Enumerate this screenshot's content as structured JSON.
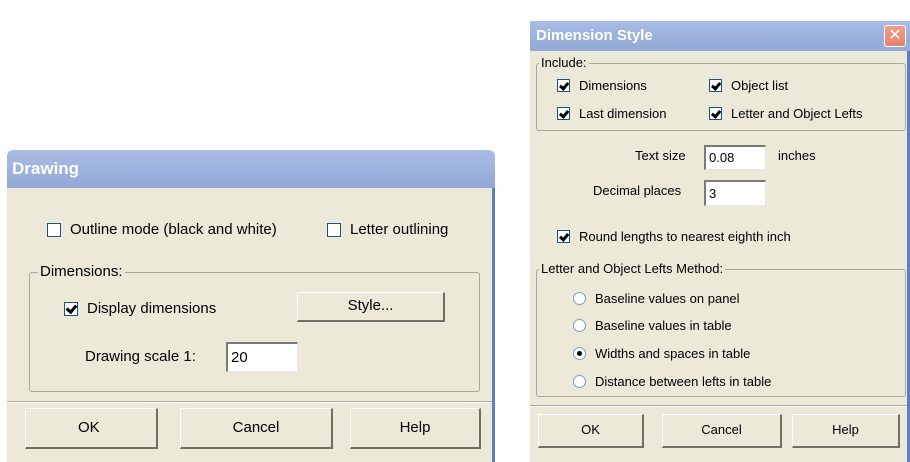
{
  "drawing_dialog": {
    "title": "Drawing",
    "outline_mode_label": "Outline mode (black and white)",
    "outline_mode_checked": false,
    "letter_outlining_label": "Letter outlining",
    "letter_outlining_checked": false,
    "dimensions_group_label": "Dimensions:",
    "display_dimensions_label": "Display dimensions",
    "display_dimensions_checked": true,
    "style_button_label": "Style...",
    "drawing_scale_label": "Drawing scale 1:",
    "drawing_scale_value": "20",
    "ok_label": "OK",
    "cancel_label": "Cancel",
    "help_label": "Help"
  },
  "dimension_style_dialog": {
    "title": "Dimension Style",
    "close_glyph": "✕",
    "include_group_label": "Include:",
    "checkboxes": [
      {
        "label": "Dimensions",
        "checked": true
      },
      {
        "label": "Object list",
        "checked": true
      },
      {
        "label": "Last dimension",
        "checked": true
      },
      {
        "label": "Letter and Object Lefts",
        "checked": true
      }
    ],
    "text_size_label": "Text size",
    "text_size_value": "0.08",
    "text_size_unit": "inches",
    "decimal_places_label": "Decimal places",
    "decimal_places_value": "3",
    "round_lengths_label": "Round lengths to nearest eighth inch",
    "round_lengths_checked": true,
    "lefts_method_group_label": "Letter and Object Lefts Method:",
    "methods": [
      {
        "label": "Baseline values on panel",
        "selected": false
      },
      {
        "label": "Baseline values in table",
        "selected": false
      },
      {
        "label": "Widths and spaces in table",
        "selected": true
      },
      {
        "label": "Distance between lefts in table",
        "selected": false
      }
    ],
    "ok_label": "OK",
    "cancel_label": "Cancel",
    "help_label": "Help"
  },
  "colors": {
    "dialog_face": "#ece9d8",
    "titlebar": "#9db3de",
    "close_button": "#e4816b"
  }
}
